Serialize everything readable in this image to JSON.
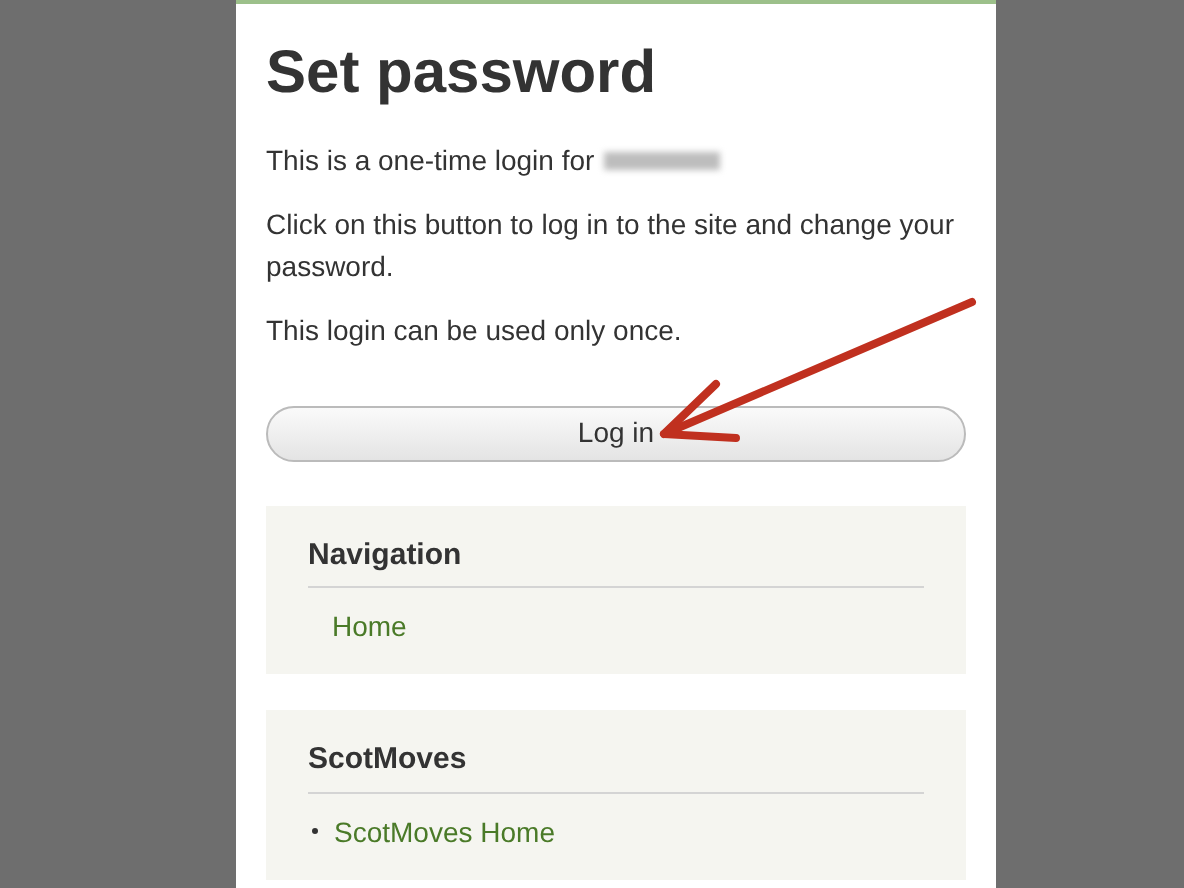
{
  "page": {
    "title": "Set password",
    "paragraphs": [
      "This is a one-time login for",
      "Click on this button to log in to the site and change your password.",
      "This login can be used only once."
    ],
    "button": "Log in"
  },
  "blocks": [
    {
      "title": "Navigation",
      "bulleted": false,
      "links": [
        "Home"
      ]
    },
    {
      "title": "ScotMoves",
      "bulleted": true,
      "links": [
        "ScotMoves Home"
      ]
    }
  ]
}
